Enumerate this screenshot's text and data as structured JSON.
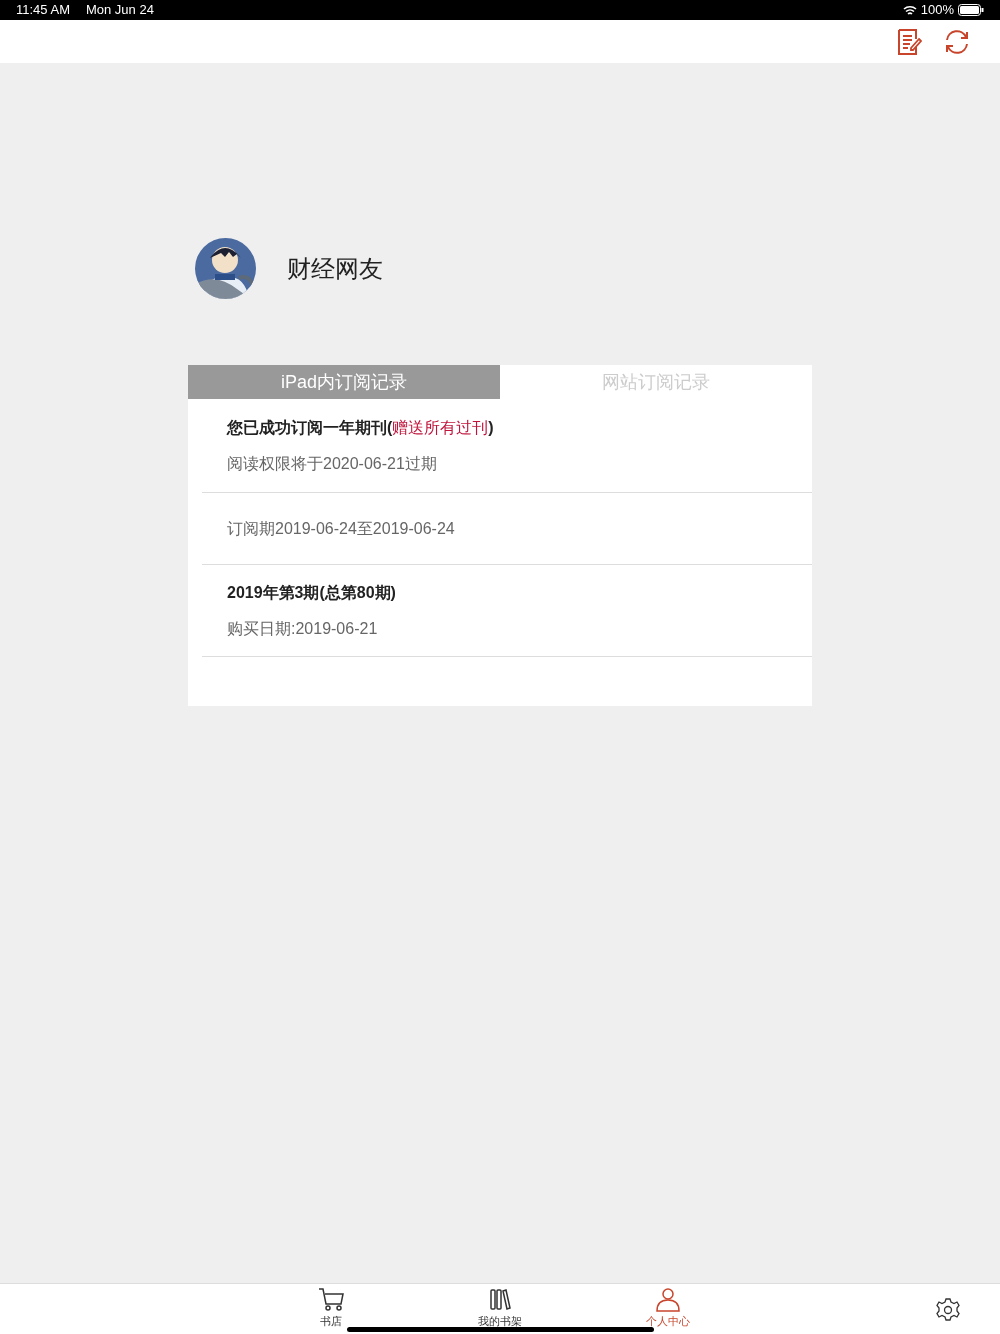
{
  "status_bar": {
    "time": "11:45 AM",
    "date": "Mon Jun 24",
    "battery": "100%"
  },
  "profile": {
    "name": "财经网友"
  },
  "tabs": [
    {
      "label": "iPad内订阅记录",
      "selected": true
    },
    {
      "label": "网站订阅记录",
      "selected": false
    }
  ],
  "records": [
    {
      "title": "您已成功订阅一年期刊(",
      "highlight": "赠送所有过刊",
      "title_end": ")",
      "detail": "阅读权限将于2020-06-21过期"
    },
    {
      "detail": "订阅期2019-06-24至2019-06-24"
    },
    {
      "title": "2019年第3期(总第80期)",
      "detail": "购买日期:2019-06-21"
    }
  ],
  "bottom_nav": [
    {
      "label": "书店",
      "kind": "store",
      "selected": false
    },
    {
      "label": "我的书架",
      "kind": "shelf",
      "selected": false
    },
    {
      "label": "个人中心",
      "kind": "profile",
      "selected": true
    }
  ]
}
